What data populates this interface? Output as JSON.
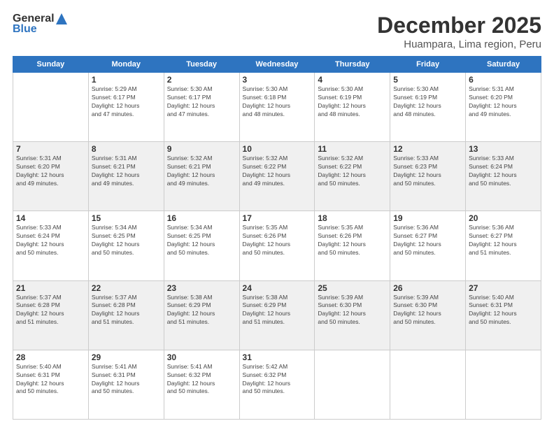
{
  "logo": {
    "general": "General",
    "blue": "Blue"
  },
  "header": {
    "month": "December 2025",
    "location": "Huampara, Lima region, Peru"
  },
  "weekdays": [
    "Sunday",
    "Monday",
    "Tuesday",
    "Wednesday",
    "Thursday",
    "Friday",
    "Saturday"
  ],
  "weeks": [
    [
      {
        "day": "",
        "info": ""
      },
      {
        "day": "1",
        "info": "Sunrise: 5:29 AM\nSunset: 6:17 PM\nDaylight: 12 hours\nand 47 minutes."
      },
      {
        "day": "2",
        "info": "Sunrise: 5:30 AM\nSunset: 6:17 PM\nDaylight: 12 hours\nand 47 minutes."
      },
      {
        "day": "3",
        "info": "Sunrise: 5:30 AM\nSunset: 6:18 PM\nDaylight: 12 hours\nand 48 minutes."
      },
      {
        "day": "4",
        "info": "Sunrise: 5:30 AM\nSunset: 6:19 PM\nDaylight: 12 hours\nand 48 minutes."
      },
      {
        "day": "5",
        "info": "Sunrise: 5:30 AM\nSunset: 6:19 PM\nDaylight: 12 hours\nand 48 minutes."
      },
      {
        "day": "6",
        "info": "Sunrise: 5:31 AM\nSunset: 6:20 PM\nDaylight: 12 hours\nand 49 minutes."
      }
    ],
    [
      {
        "day": "7",
        "info": "Sunrise: 5:31 AM\nSunset: 6:20 PM\nDaylight: 12 hours\nand 49 minutes."
      },
      {
        "day": "8",
        "info": "Sunrise: 5:31 AM\nSunset: 6:21 PM\nDaylight: 12 hours\nand 49 minutes."
      },
      {
        "day": "9",
        "info": "Sunrise: 5:32 AM\nSunset: 6:21 PM\nDaylight: 12 hours\nand 49 minutes."
      },
      {
        "day": "10",
        "info": "Sunrise: 5:32 AM\nSunset: 6:22 PM\nDaylight: 12 hours\nand 49 minutes."
      },
      {
        "day": "11",
        "info": "Sunrise: 5:32 AM\nSunset: 6:22 PM\nDaylight: 12 hours\nand 50 minutes."
      },
      {
        "day": "12",
        "info": "Sunrise: 5:33 AM\nSunset: 6:23 PM\nDaylight: 12 hours\nand 50 minutes."
      },
      {
        "day": "13",
        "info": "Sunrise: 5:33 AM\nSunset: 6:24 PM\nDaylight: 12 hours\nand 50 minutes."
      }
    ],
    [
      {
        "day": "14",
        "info": "Sunrise: 5:33 AM\nSunset: 6:24 PM\nDaylight: 12 hours\nand 50 minutes."
      },
      {
        "day": "15",
        "info": "Sunrise: 5:34 AM\nSunset: 6:25 PM\nDaylight: 12 hours\nand 50 minutes."
      },
      {
        "day": "16",
        "info": "Sunrise: 5:34 AM\nSunset: 6:25 PM\nDaylight: 12 hours\nand 50 minutes."
      },
      {
        "day": "17",
        "info": "Sunrise: 5:35 AM\nSunset: 6:26 PM\nDaylight: 12 hours\nand 50 minutes."
      },
      {
        "day": "18",
        "info": "Sunrise: 5:35 AM\nSunset: 6:26 PM\nDaylight: 12 hours\nand 50 minutes."
      },
      {
        "day": "19",
        "info": "Sunrise: 5:36 AM\nSunset: 6:27 PM\nDaylight: 12 hours\nand 50 minutes."
      },
      {
        "day": "20",
        "info": "Sunrise: 5:36 AM\nSunset: 6:27 PM\nDaylight: 12 hours\nand 51 minutes."
      }
    ],
    [
      {
        "day": "21",
        "info": "Sunrise: 5:37 AM\nSunset: 6:28 PM\nDaylight: 12 hours\nand 51 minutes."
      },
      {
        "day": "22",
        "info": "Sunrise: 5:37 AM\nSunset: 6:28 PM\nDaylight: 12 hours\nand 51 minutes."
      },
      {
        "day": "23",
        "info": "Sunrise: 5:38 AM\nSunset: 6:29 PM\nDaylight: 12 hours\nand 51 minutes."
      },
      {
        "day": "24",
        "info": "Sunrise: 5:38 AM\nSunset: 6:29 PM\nDaylight: 12 hours\nand 51 minutes."
      },
      {
        "day": "25",
        "info": "Sunrise: 5:39 AM\nSunset: 6:30 PM\nDaylight: 12 hours\nand 50 minutes."
      },
      {
        "day": "26",
        "info": "Sunrise: 5:39 AM\nSunset: 6:30 PM\nDaylight: 12 hours\nand 50 minutes."
      },
      {
        "day": "27",
        "info": "Sunrise: 5:40 AM\nSunset: 6:31 PM\nDaylight: 12 hours\nand 50 minutes."
      }
    ],
    [
      {
        "day": "28",
        "info": "Sunrise: 5:40 AM\nSunset: 6:31 PM\nDaylight: 12 hours\nand 50 minutes."
      },
      {
        "day": "29",
        "info": "Sunrise: 5:41 AM\nSunset: 6:31 PM\nDaylight: 12 hours\nand 50 minutes."
      },
      {
        "day": "30",
        "info": "Sunrise: 5:41 AM\nSunset: 6:32 PM\nDaylight: 12 hours\nand 50 minutes."
      },
      {
        "day": "31",
        "info": "Sunrise: 5:42 AM\nSunset: 6:32 PM\nDaylight: 12 hours\nand 50 minutes."
      },
      {
        "day": "",
        "info": ""
      },
      {
        "day": "",
        "info": ""
      },
      {
        "day": "",
        "info": ""
      }
    ]
  ]
}
